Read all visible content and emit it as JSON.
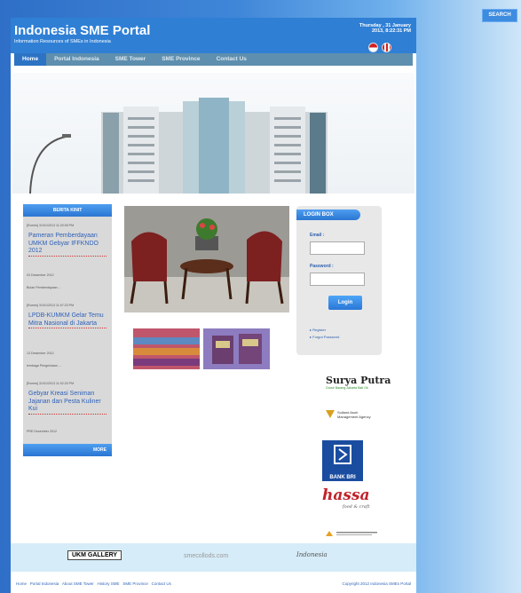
{
  "search": {
    "label": "SEARCH"
  },
  "header": {
    "title": "Indonesia SME Portal",
    "subtitle": "Information Resources of SMEs in Indonesia",
    "date": "Thursday , 31 January",
    "time": "2013, 8:22:31 PM"
  },
  "nav": {
    "items": [
      {
        "label": "Home"
      },
      {
        "label": "Portal Indonesia"
      },
      {
        "label": "SME Tower"
      },
      {
        "label": "SME Province"
      },
      {
        "label": "Contact Us"
      }
    ]
  },
  "news": {
    "header": "BERITA KINIT",
    "items": [
      {
        "meta": "[Events] 31/01/2013 11:20:05 PM",
        "title": "Pameran Pemberdayaan UMKM Gebyar IFFKNDO 2012",
        "date": "03 Desember 2012",
        "excerpt": "Bulan Pemberdayaan ..."
      },
      {
        "meta": "[Events] 31/01/2013 11:07:23 PM",
        "title": "LPDB-KUMKM Gelar Temu Mitra Nasional di Jakarta",
        "date": "13 Desember 2012",
        "excerpt": "lembaga Pengelolaan ..."
      },
      {
        "meta": "[Events] 31/01/2013 11:02:20 PM",
        "title": "Gebyar Kreasi Seniman Jajanan dan Pesta Kuliner Kui",
        "date": "PRE Desember 2012",
        "excerpt": ""
      }
    ],
    "more": "MORE"
  },
  "login": {
    "title": "LOGIN BOX",
    "email_label": "Email :",
    "password_label": "Password :",
    "button": "Login",
    "links": [
      "Register",
      "Forgot Password"
    ]
  },
  "sponsors": {
    "surya_title": "Surya Putra",
    "surya_sub": "Grosir Barang Jakarta Bali Ok",
    "sumber_title": "Sulland Asuh",
    "sumber_sub": "Management Agency",
    "bri": "BANK BRI",
    "hassa": "hassa",
    "hassa_sub": "food & craft"
  },
  "footer": {
    "logo1": "UKM GALLERY",
    "logo2": "smecollods.com",
    "logo3": "Indonesia",
    "nav": [
      "Home",
      "Portal Indonesia",
      "About SME Tower",
      "History SME",
      "SME Province",
      "Contact Us"
    ],
    "copyright": "Copyright 2012 Indonesia SMEs Portal"
  },
  "colors": {
    "header_blue": "#2f7fd5",
    "link_blue": "#2f61b8",
    "nav_bg": "#5e8fae"
  }
}
